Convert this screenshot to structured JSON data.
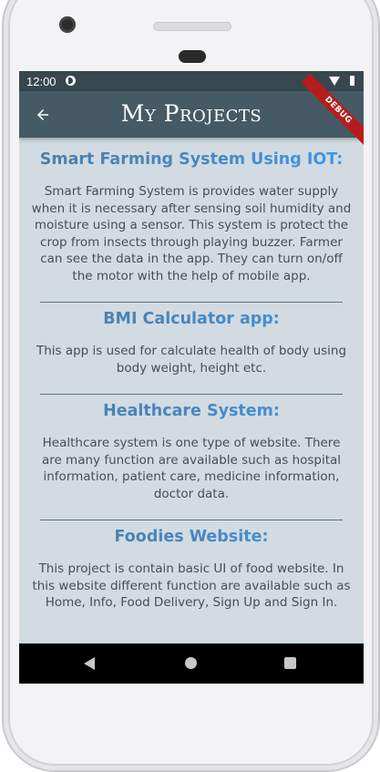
{
  "status": {
    "time": "12:00"
  },
  "appbar": {
    "title": "My Projects",
    "back_icon": "arrow-back-icon",
    "debug_label": "DEBUG",
    "color": "#455a64"
  },
  "projects": [
    {
      "title": "Smart Farming System Using IOT:",
      "description": "Smart Farming System is provides water supply when it is necessary after sensing soil humidity and moisture using a sensor. This system is protect the crop from insects through playing buzzer. Farmer can see the data in the app. They can turn on/off the motor with the help of mobile app."
    },
    {
      "title": "BMI Calculator app:",
      "description": "This app is used for calculate health of body using body weight, height etc."
    },
    {
      "title": "Healthcare System:",
      "description": "Healthcare system is one type of website. There are many function are available such as hospital information, patient care, medicine information, doctor data."
    },
    {
      "title": "Foodies Website:",
      "description": "This project is contain basic UI of food website. In this website different function are available such as Home, Info, Food Delivery, Sign Up and Sign In."
    }
  ],
  "navbar": {
    "back_icon": "nav-back-icon",
    "home_icon": "nav-home-icon",
    "recent_icon": "nav-recent-apps-icon"
  },
  "colors": {
    "background": "#d2dbe1",
    "title_gradient_start": "#4a7fa6",
    "title_gradient_end": "#3a9cf0",
    "text": "#4a4d50"
  }
}
